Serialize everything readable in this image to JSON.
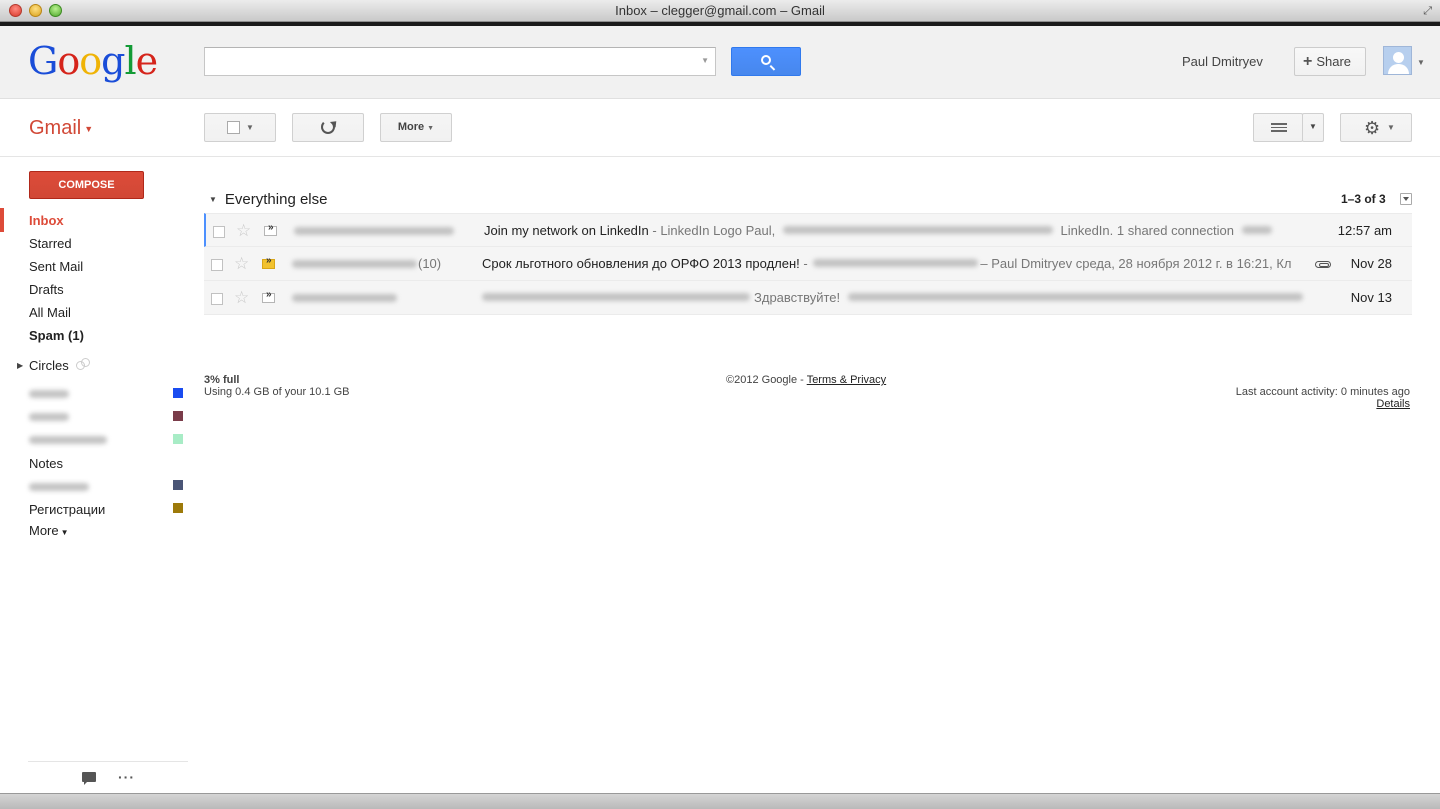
{
  "window": {
    "title": "Inbox – clegger@gmail.com – Gmail"
  },
  "header": {
    "search_value": "",
    "user_name": "Paul Dmitryev",
    "share_label": "Share"
  },
  "toolbar": {
    "app_label": "Gmail",
    "more_label": "More"
  },
  "sidebar": {
    "compose_label": "COMPOSE",
    "items": [
      {
        "label": "Inbox"
      },
      {
        "label": "Starred"
      },
      {
        "label": "Sent Mail"
      },
      {
        "label": "Drafts"
      },
      {
        "label": "All Mail"
      },
      {
        "label": "Spam (1)"
      }
    ],
    "circles_label": "Circles",
    "labels": [
      {
        "label": "Notes"
      },
      {
        "label": "Регистрации",
        "color": "#9d7a0a"
      }
    ],
    "more_label": "More",
    "label_colors": [
      "#1a4cf0",
      "#7a3c4a",
      "#a8ecc6",
      "#4a5576",
      "#9d7a0a"
    ]
  },
  "main": {
    "section_title": "Everything else",
    "pagination": "1–3 of 3",
    "messages": [
      {
        "subject": "Join my network on LinkedIn",
        "snippet_a": " - LinkedIn Logo Paul,",
        "snippet_b": "LinkedIn. 1 shared connection",
        "date": "12:57 am",
        "important": false
      },
      {
        "subject": "Срок льготного обновления до ОРФО 2013 продлен!",
        "snippet_a": " -",
        "snippet_b": "– Paul Dmitryev среда, 28 ноября 2012 г. в 16:21, Кл",
        "date": "Nov 28",
        "important": true,
        "count": "(10)"
      },
      {
        "subject": "",
        "snippet_a": "",
        "snippet_b": "Здравствуйте!",
        "date": "Nov 13",
        "important": false
      }
    ]
  },
  "footer": {
    "quota_percent": "3% full",
    "quota_usage": "Using 0.4 GB of your 10.1 GB",
    "copyright": "©2012 Google - ",
    "terms_link": "Terms & Privacy",
    "last_activity": "Last account activity: 0 minutes ago",
    "details_link": "Details"
  }
}
